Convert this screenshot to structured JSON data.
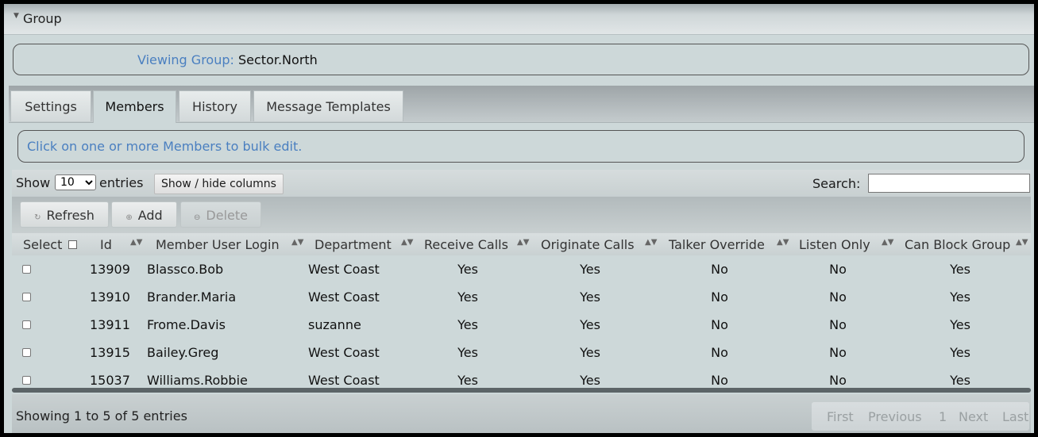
{
  "group_panel": {
    "title": "Group"
  },
  "viewing": {
    "label": "Viewing Group:",
    "value": "Sector.North"
  },
  "tabs": [
    {
      "label": "Settings"
    },
    {
      "label": "Members",
      "active": true
    },
    {
      "label": "History"
    },
    {
      "label": "Message Templates"
    }
  ],
  "hint": "Click on one or more Members to bulk edit.",
  "length_control": {
    "show_label": "Show",
    "selected": "10",
    "entries_label": "entries"
  },
  "show_hide_columns_label": "Show / hide columns",
  "search": {
    "label": "Search:",
    "value": ""
  },
  "actions": {
    "refresh": "Refresh",
    "add": "Add",
    "delete": "Delete"
  },
  "columns": [
    "Select",
    "Id",
    "Member User Login",
    "Department",
    "Receive Calls",
    "Originate Calls",
    "Talker Override",
    "Listen Only",
    "Can Block Group"
  ],
  "rows": [
    {
      "id": "13909",
      "login": "Blassco.Bob",
      "department": "West Coast",
      "receive": "Yes",
      "originate": "Yes",
      "talker": "No",
      "listen": "No",
      "block": "Yes"
    },
    {
      "id": "13910",
      "login": "Brander.Maria",
      "department": "West Coast",
      "receive": "Yes",
      "originate": "Yes",
      "talker": "No",
      "listen": "No",
      "block": "Yes"
    },
    {
      "id": "13911",
      "login": "Frome.Davis",
      "department": "suzanne",
      "receive": "Yes",
      "originate": "Yes",
      "talker": "No",
      "listen": "No",
      "block": "Yes"
    },
    {
      "id": "13915",
      "login": "Bailey.Greg",
      "department": "West Coast",
      "receive": "Yes",
      "originate": "Yes",
      "talker": "No",
      "listen": "No",
      "block": "Yes"
    },
    {
      "id": "15037",
      "login": "Williams.Robbie",
      "department": "West Coast",
      "receive": "Yes",
      "originate": "Yes",
      "talker": "No",
      "listen": "No",
      "block": "Yes"
    }
  ],
  "footer": {
    "info": "Showing 1 to 5 of 5 entries",
    "pager": {
      "first": "First",
      "previous": "Previous",
      "page": "1",
      "next": "Next",
      "last": "Last"
    }
  }
}
